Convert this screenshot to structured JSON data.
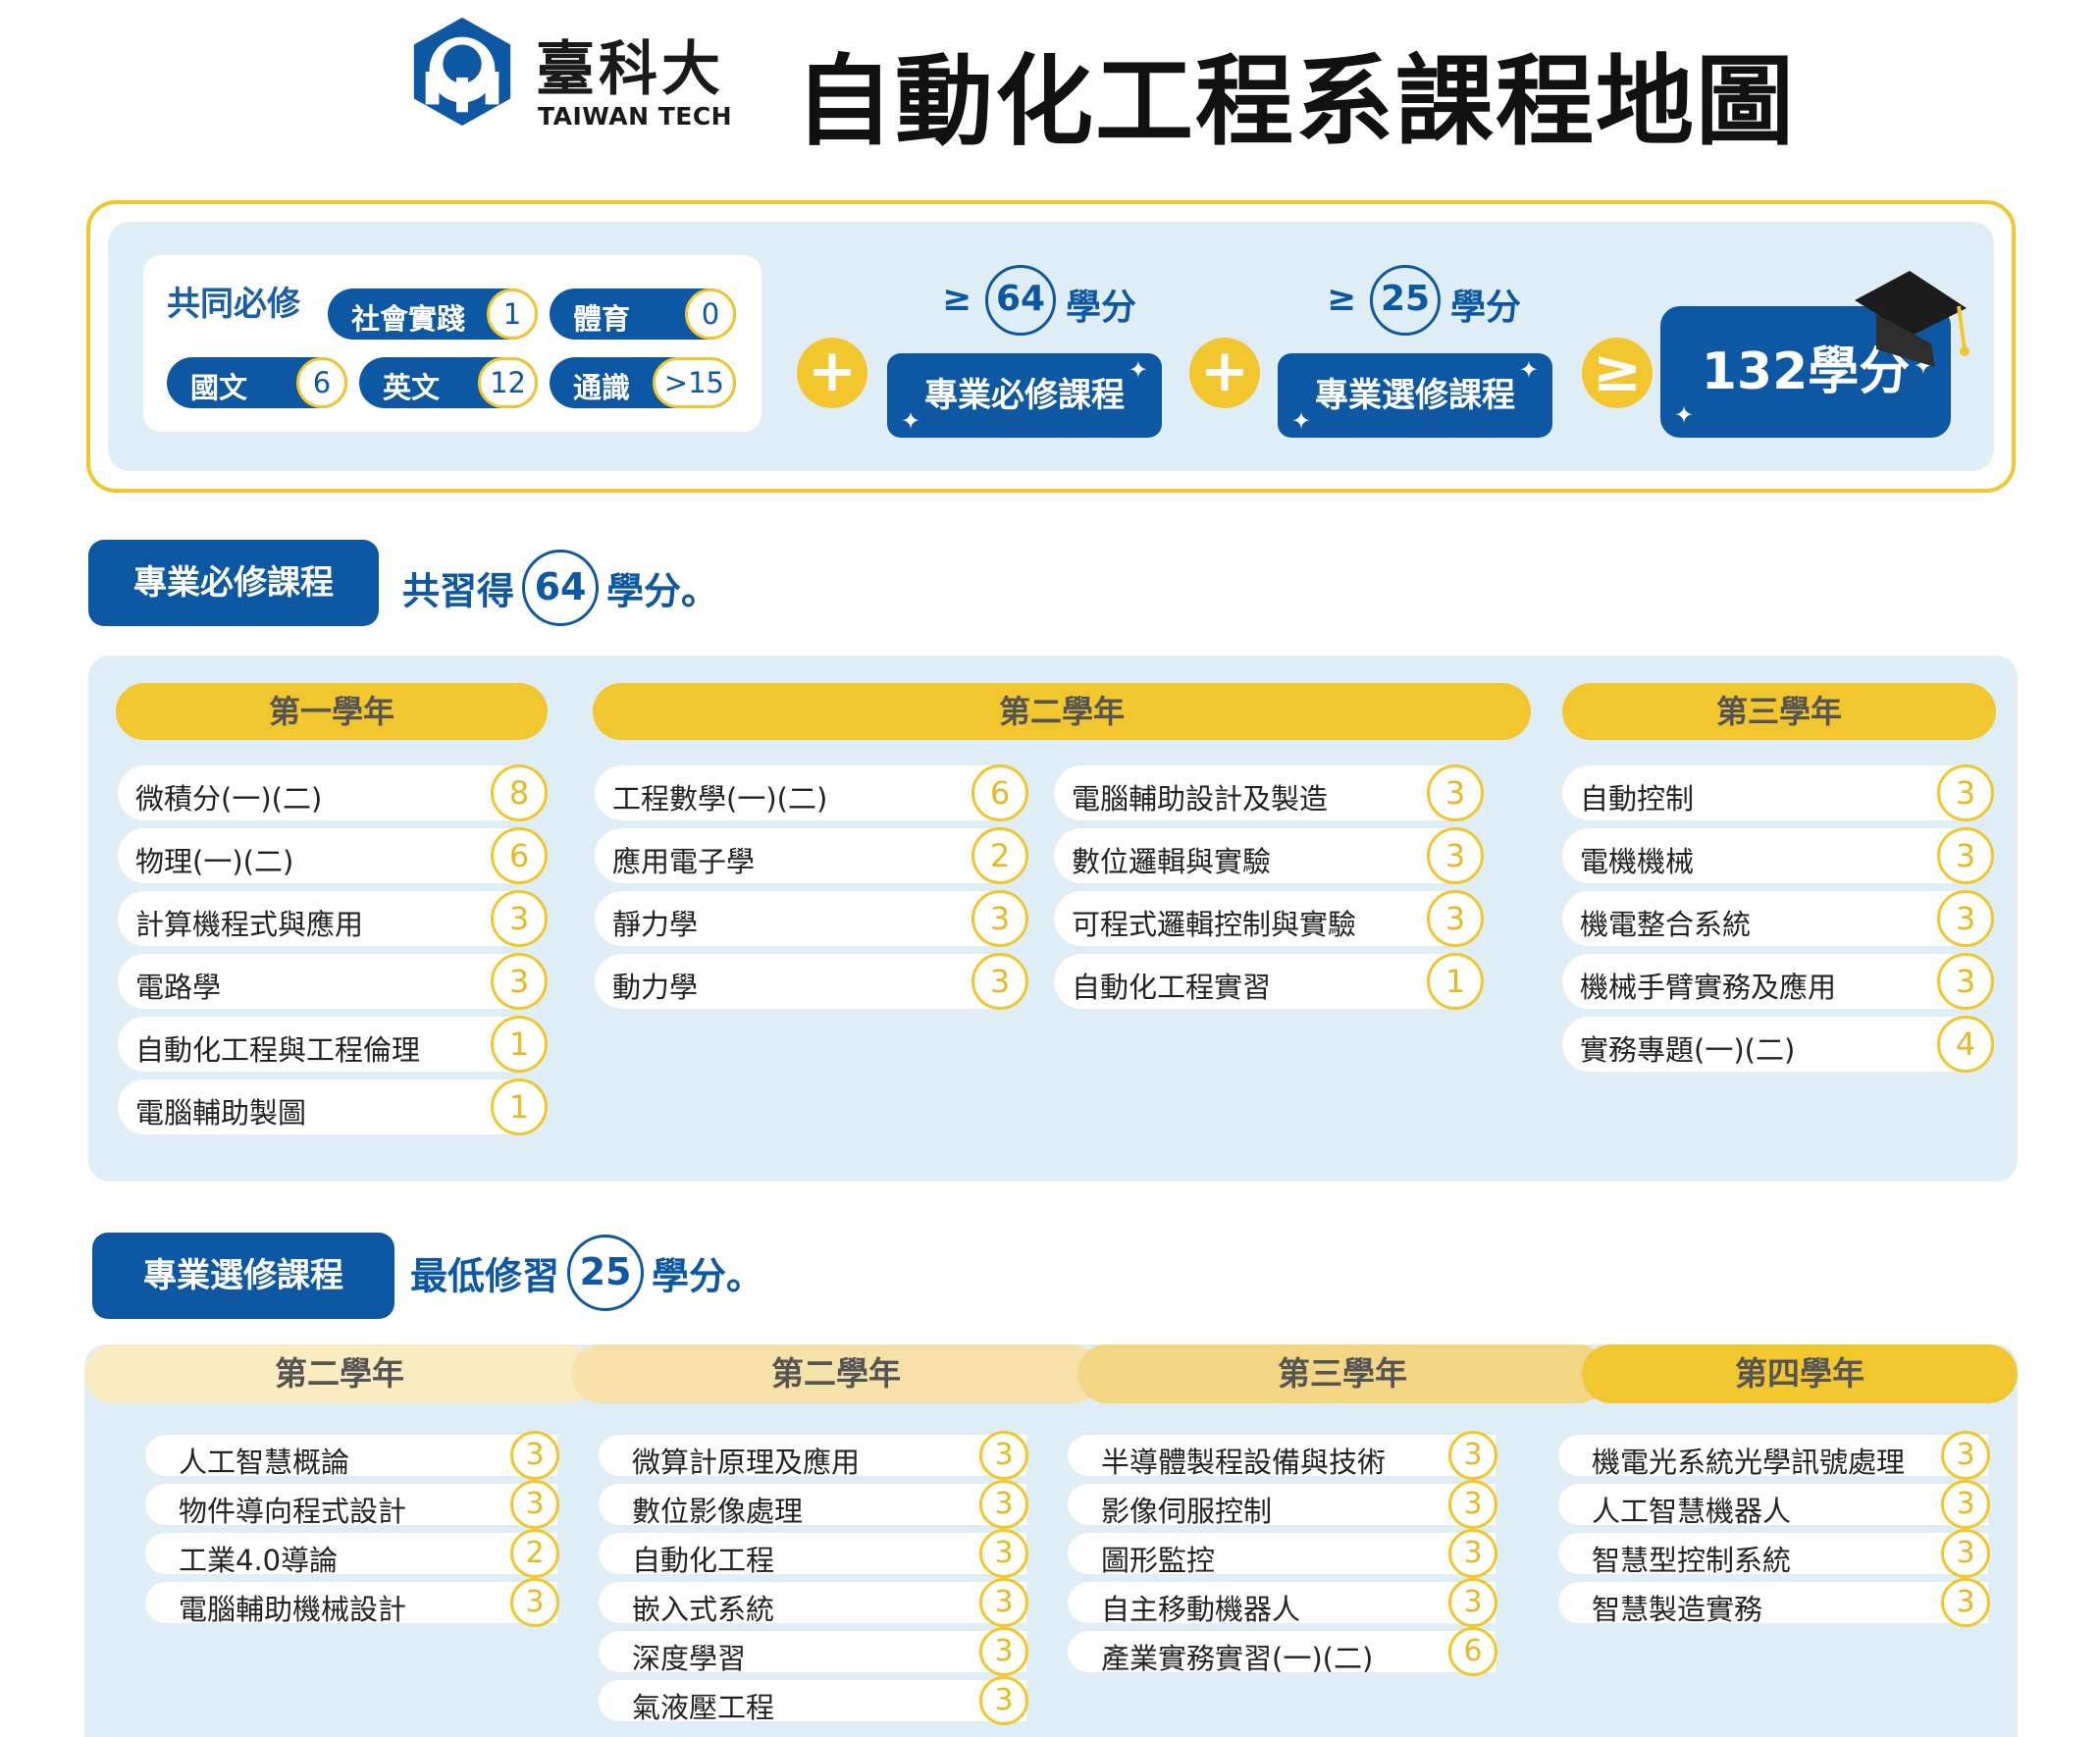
{
  "header": {
    "logo_cn": "臺科大",
    "logo_en": "TAIWAN TECH",
    "title": "自動化工程系課程地圖"
  },
  "summary": {
    "common": {
      "title": "共同必修",
      "items": [
        {
          "label": "社會實踐",
          "credits": "1"
        },
        {
          "label": "體育",
          "credits": "0"
        },
        {
          "label": "國文",
          "credits": "6"
        },
        {
          "label": "英文",
          "credits": "12"
        },
        {
          "label": "通識",
          "credits": ">15"
        }
      ]
    },
    "plus": "+",
    "geq": "≥",
    "required": {
      "ge": "≥",
      "credits": "64",
      "unit": "學分",
      "label": "專業必修課程"
    },
    "elective": {
      "ge": "≥",
      "credits": "25",
      "unit": "學分",
      "label": "專業選修課程"
    },
    "total": "132學分"
  },
  "required_section": {
    "label": "專業必修課程",
    "note_prefix": "共習得",
    "credits": "64",
    "note_suffix": "學分。",
    "years": [
      {
        "title": "第一學年",
        "columns": [
          [
            {
              "name": "微積分(一)(二)",
              "credits": "8"
            },
            {
              "name": "物理(一)(二)",
              "credits": "6"
            },
            {
              "name": "計算機程式與應用",
              "credits": "3"
            },
            {
              "name": "電路學",
              "credits": "3"
            },
            {
              "name": "自動化工程與工程倫理",
              "credits": "1"
            },
            {
              "name": "電腦輔助製圖",
              "credits": "1"
            }
          ]
        ]
      },
      {
        "title": "第二學年",
        "columns": [
          [
            {
              "name": "工程數學(一)(二)",
              "credits": "6"
            },
            {
              "name": "應用電子學",
              "credits": "2"
            },
            {
              "name": "靜力學",
              "credits": "3"
            },
            {
              "name": "動力學",
              "credits": "3"
            }
          ],
          [
            {
              "name": "電腦輔助設計及製造",
              "credits": "3"
            },
            {
              "name": "數位邏輯與實驗",
              "credits": "3"
            },
            {
              "name": "可程式邏輯控制與實驗",
              "credits": "3"
            },
            {
              "name": "自動化工程實習",
              "credits": "1"
            }
          ]
        ]
      },
      {
        "title": "第三學年",
        "columns": [
          [
            {
              "name": "自動控制",
              "credits": "3"
            },
            {
              "name": "電機機械",
              "credits": "3"
            },
            {
              "name": "機電整合系統",
              "credits": "3"
            },
            {
              "name": "機械手臂實務及應用",
              "credits": "3"
            },
            {
              "name": "實務專題(一)(二)",
              "credits": "4"
            }
          ]
        ]
      }
    ]
  },
  "elective_section": {
    "label": "專業選修課程",
    "note_prefix": "最低修習",
    "credits": "25",
    "note_suffix": "學分。",
    "years": [
      {
        "title": "第二學年",
        "color": "#faebc0",
        "courses": [
          {
            "name": "人工智慧概論",
            "credits": "3"
          },
          {
            "name": "物件導向程式設計",
            "credits": "3"
          },
          {
            "name": "工業4.0導論",
            "credits": "2"
          },
          {
            "name": "電腦輔助機械設計",
            "credits": "3"
          }
        ]
      },
      {
        "title": "第二學年",
        "color": "#f6e2a8",
        "courses": [
          {
            "name": "微算計原理及應用",
            "credits": "3"
          },
          {
            "name": "數位影像處理",
            "credits": "3"
          },
          {
            "name": "自動化工程",
            "credits": "3"
          },
          {
            "name": "嵌入式系統",
            "credits": "3"
          },
          {
            "name": "深度學習",
            "credits": "3"
          },
          {
            "name": "氣液壓工程",
            "credits": "3"
          }
        ]
      },
      {
        "title": "第三學年",
        "color": "#f2d683",
        "courses": [
          {
            "name": "半導體製程設備與技術",
            "credits": "3"
          },
          {
            "name": "影像伺服控制",
            "credits": "3"
          },
          {
            "name": "圖形監控",
            "credits": "3"
          },
          {
            "name": "自主移動機器人",
            "credits": "3"
          },
          {
            "name": "產業實務實習(一)(二)",
            "credits": "6"
          }
        ]
      },
      {
        "title": "第四學年",
        "color": "#f2c62f",
        "courses": [
          {
            "name": "機電光系統光學訊號處理",
            "credits": "3"
          },
          {
            "name": "人工智慧機器人",
            "credits": "3"
          },
          {
            "name": "智慧型控制系統",
            "credits": "3"
          },
          {
            "name": "智慧製造實務",
            "credits": "3"
          }
        ]
      }
    ]
  }
}
